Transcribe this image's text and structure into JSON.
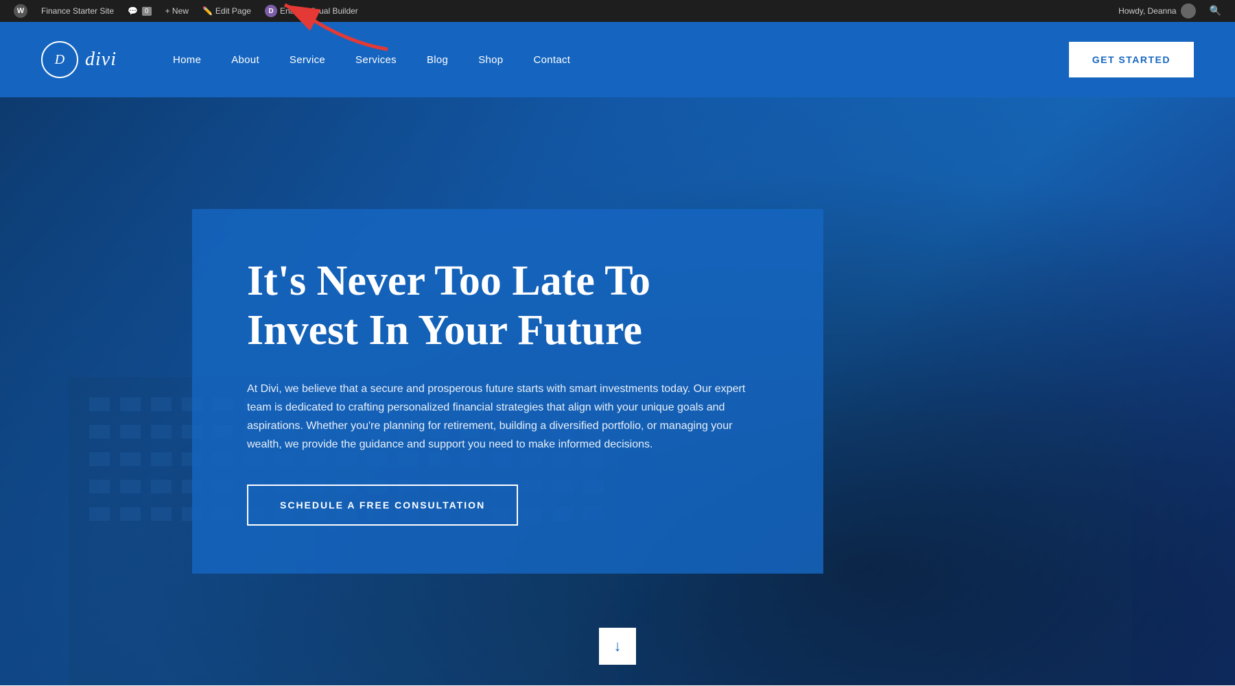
{
  "admin_bar": {
    "site_name": "Finance Starter Site",
    "wp_icon": "W",
    "comment_count": "0",
    "new_label": "+ New",
    "edit_label": "Edit Page",
    "divi_label": "Enable Visual Builder",
    "divi_icon": "D",
    "howdy": "Howdy, Deanna",
    "search_icon": "🔍"
  },
  "header": {
    "logo_letter": "D",
    "logo_text": "divi",
    "nav_items": [
      {
        "label": "Home",
        "id": "home"
      },
      {
        "label": "About",
        "id": "about"
      },
      {
        "label": "Service",
        "id": "service"
      },
      {
        "label": "Services",
        "id": "services"
      },
      {
        "label": "Blog",
        "id": "blog"
      },
      {
        "label": "Shop",
        "id": "shop"
      },
      {
        "label": "Contact",
        "id": "contact"
      }
    ],
    "cta_label": "GET STARTED"
  },
  "hero": {
    "headline": "It's Never Too Late To Invest In Your Future",
    "body": "At Divi, we believe that a secure and prosperous future starts with smart investments today. Our expert team is dedicated to crafting personalized financial strategies that align with your unique goals and aspirations. Whether you're planning for retirement, building a diversified portfolio, or managing your wealth, we provide the guidance and support you need to make informed decisions.",
    "cta_label": "SCHEDULE A FREE CONSULTATION",
    "scroll_arrow": "↓"
  },
  "colors": {
    "admin_bar_bg": "#1e1e1e",
    "header_bg": "#1565c0",
    "hero_bg_start": "#0d3a6e",
    "hero_bg_end": "#1976d2",
    "white": "#ffffff",
    "cta_text": "#1565c0"
  }
}
